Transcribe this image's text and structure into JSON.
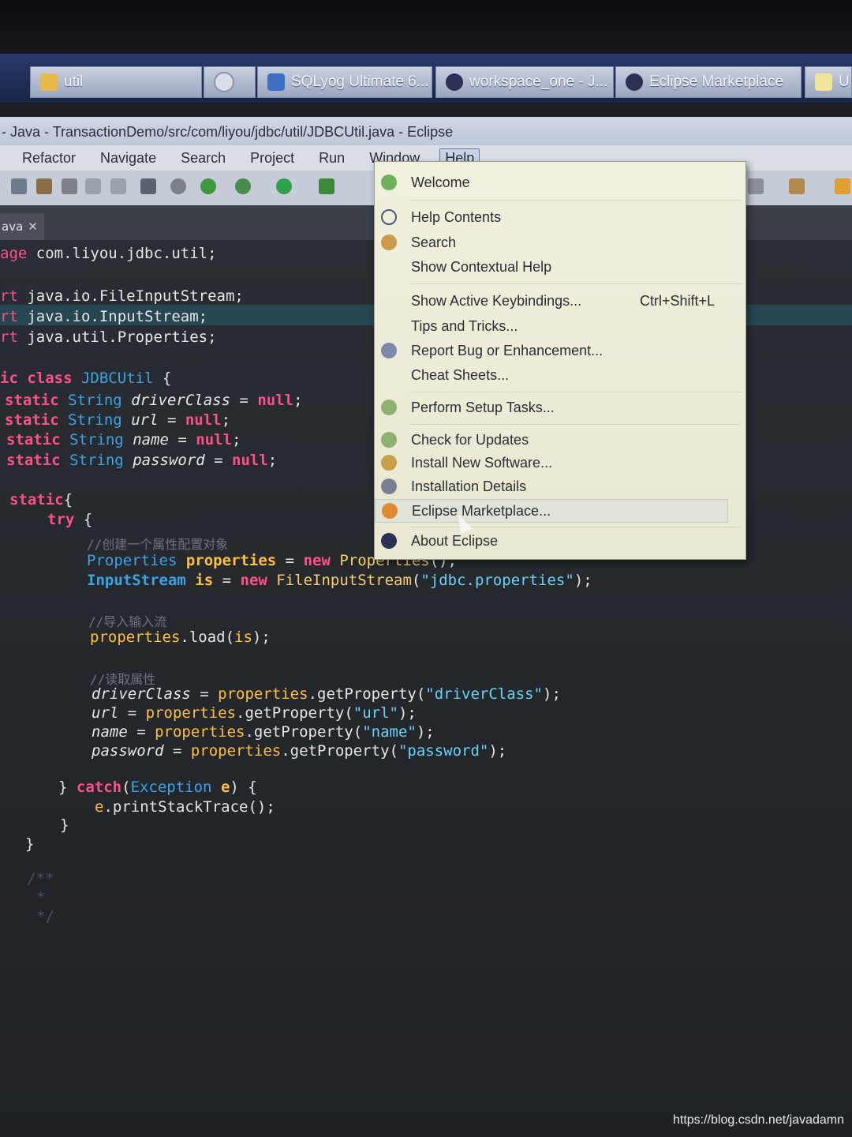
{
  "taskbar": {
    "items": [
      {
        "label": "util",
        "icon": "folder-icon"
      },
      {
        "label": "",
        "icon": "chrome-icon"
      },
      {
        "label": "SQLyog Ultimate 6...",
        "icon": "sqlyog-icon"
      },
      {
        "label": "workspace_one - J...",
        "icon": "eclipse-icon"
      },
      {
        "label": "Eclipse Marketplace",
        "icon": "eclipse-icon"
      },
      {
        "label": "U",
        "icon": "notepad-icon"
      }
    ]
  },
  "window": {
    "title": "- Java - TransactionDemo/src/com/liyou/jdbc/util/JDBCUtil.java - Eclipse"
  },
  "menubar": {
    "items": [
      "Refactor",
      "Navigate",
      "Search",
      "Project",
      "Run",
      "Window",
      "Help"
    ],
    "active": "Help"
  },
  "editor": {
    "tab_label": "ava",
    "lines": {
      "l1": "age com.liyou.jdbc.util;",
      "l2": "rt java.io.FileInputStream;",
      "l3": "rt java.io.InputStream;",
      "l4": "rt java.util.Properties;",
      "c1": "//创建一个属性配置对象",
      "c2": "//导入输入流",
      "c3": "//读取属性"
    }
  },
  "help_menu": {
    "items": [
      {
        "label": "Welcome",
        "icon": "welcome-icon"
      },
      {
        "label": "Help Contents",
        "icon": "help-icon"
      },
      {
        "label": "Search",
        "icon": "search-icon"
      },
      {
        "label": "Show Contextual Help",
        "icon": ""
      },
      {
        "label": "Show Active Keybindings...",
        "shortcut": "Ctrl+Shift+L",
        "icon": ""
      },
      {
        "label": "Tips and Tricks...",
        "icon": ""
      },
      {
        "label": "Report Bug or Enhancement...",
        "icon": "bug-icon"
      },
      {
        "label": "Cheat Sheets...",
        "icon": ""
      },
      {
        "label": "Perform Setup Tasks...",
        "icon": "setup-icon"
      },
      {
        "label": "Check for Updates",
        "icon": "update-icon"
      },
      {
        "label": "Install New Software...",
        "icon": "install-icon"
      },
      {
        "label": "Installation Details",
        "icon": "details-icon"
      },
      {
        "label": "Eclipse Marketplace...",
        "icon": "marketplace-icon"
      },
      {
        "label": "About Eclipse",
        "icon": "eclipse-icon"
      }
    ]
  },
  "watermark": "https://blog.csdn.net/javadamn"
}
